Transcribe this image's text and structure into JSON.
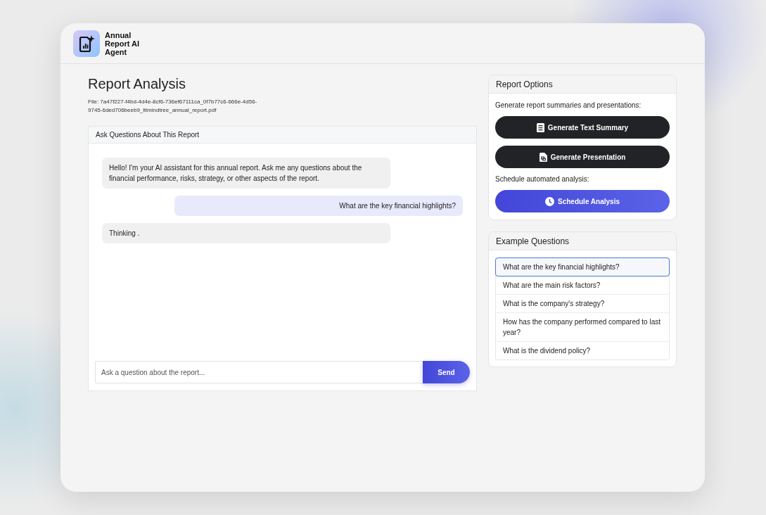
{
  "app": {
    "title": "Annual Report AI Agent"
  },
  "page": {
    "title": "Report Analysis",
    "file": "File: 7a47f227-f4bd-4d4e-8cf6-736ef67111ca_0f7b77c6-666e-4d56-9745-6ded706beeb9_ltimindtree_annual_report.pdf"
  },
  "chat": {
    "title": "Ask Questions About This Report",
    "messages": [
      {
        "kind": "assistant",
        "text": "Hello! I'm your AI assistant for this annual report. Ask me any questions about the financial performance, risks, strategy, or other aspects of the report."
      },
      {
        "kind": "user",
        "text": "What are the key financial highlights?"
      },
      {
        "kind": "assistant",
        "text": "Thinking ."
      }
    ],
    "input": {
      "placeholder": "Ask a question about the report..."
    },
    "send": "Send"
  },
  "report_options": {
    "title": "Report Options",
    "sections": [
      {
        "label": "Generate report summaries and presentations:",
        "buttons": [
          {
            "label": "Generate Text Summary",
            "kind": "summary"
          },
          {
            "label": "Generate Presentation",
            "kind": "presentation"
          }
        ]
      },
      {
        "label": "Schedule automated analysis:",
        "buttons": [
          {
            "label": "Schedule Analysis",
            "kind": "schedule"
          }
        ]
      }
    ]
  },
  "example_questions": {
    "title": "Example Questions",
    "items": [
      {
        "text": "What are the key financial highlights?",
        "selected": true
      },
      {
        "text": "What are the main risk factors?",
        "selected": false
      },
      {
        "text": "What is the company's strategy?",
        "selected": false
      },
      {
        "text": "How has the company performed compared to last year?",
        "selected": false
      },
      {
        "text": "What is the dividend policy?",
        "selected": false
      }
    ]
  }
}
